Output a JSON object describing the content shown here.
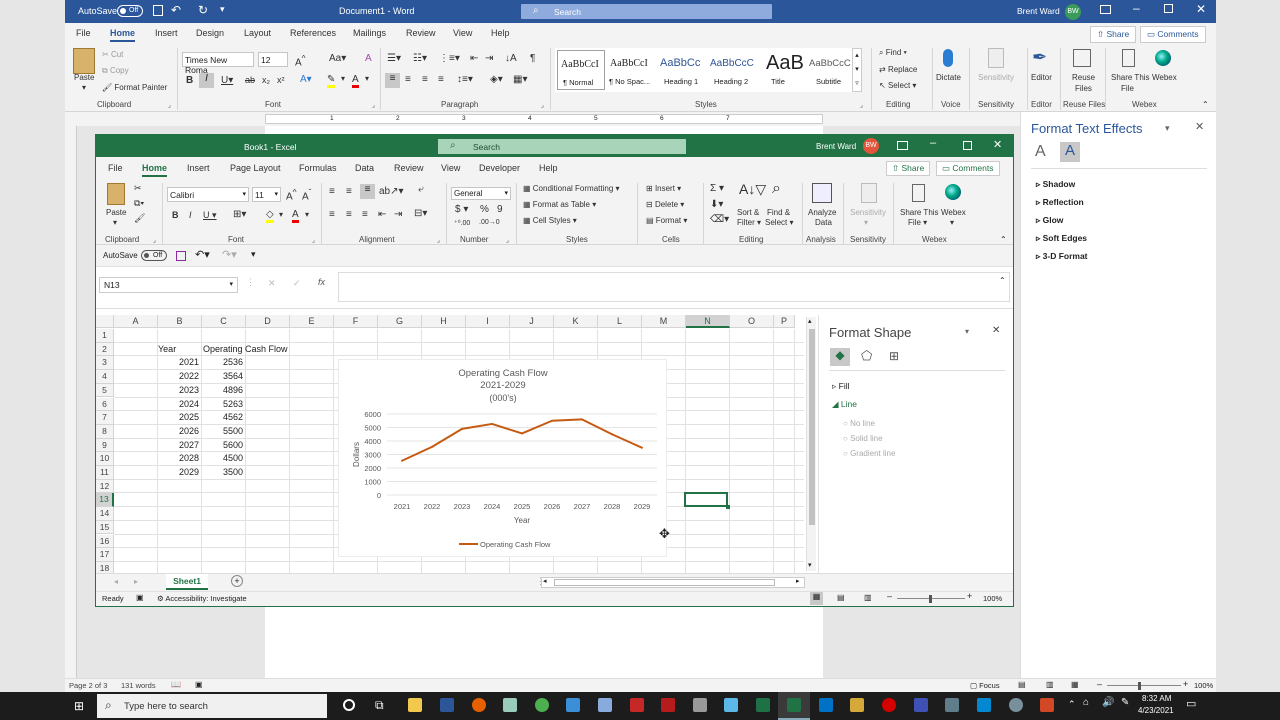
{
  "word": {
    "autosave_label": "AutoSave",
    "autosave_state": "Off",
    "doc_title": "Document1 - Word",
    "search_placeholder": "Search",
    "user_name": "Brent Ward",
    "user_initials": "BW",
    "tabs": [
      "File",
      "Home",
      "Insert",
      "Design",
      "Layout",
      "References",
      "Mailings",
      "Review",
      "View",
      "Help"
    ],
    "share": "Share",
    "comments": "Comments",
    "clipboard": {
      "paste": "Paste",
      "cut": "Cut",
      "copy": "Copy",
      "format_painter": "Format Painter",
      "label": "Clipboard"
    },
    "font": {
      "name": "Times New Roma",
      "size": "12",
      "label": "Font"
    },
    "paragraph_label": "Paragraph",
    "styles": [
      {
        "preview": "AaBbCcI",
        "name": "¶ Normal"
      },
      {
        "preview": "AaBbCcI",
        "name": "¶ No Spac..."
      },
      {
        "preview": "AaBbCc",
        "name": "Heading 1"
      },
      {
        "preview": "AaBbCcC",
        "name": "Heading 2"
      },
      {
        "preview": "AaB",
        "name": "Title"
      },
      {
        "preview": "AaBbCcC",
        "name": "Subtitle"
      }
    ],
    "styles_label": "Styles",
    "editing": {
      "find": "Find",
      "replace": "Replace",
      "select": "Select",
      "label": "Editing"
    },
    "voice": {
      "dictate": "Dictate",
      "label": "Voice"
    },
    "sensitivity": {
      "btn": "Sensitivity",
      "label": "Sensitivity"
    },
    "editor": {
      "btn": "Editor",
      "label": "Editor"
    },
    "reuse": {
      "btn1": "Reuse",
      "btn2": "Files",
      "label": "Reuse Files"
    },
    "webex": {
      "share1": "Share This",
      "share2": "File",
      "webex": "Webex",
      "label": "Webex"
    },
    "ruler_numbers": [
      "1",
      "2",
      "3",
      "4",
      "5",
      "6",
      "7"
    ],
    "status": {
      "page": "Page 2 of 3",
      "words": "131 words",
      "focus": "Focus",
      "zoom": "100%"
    },
    "fte": {
      "title": "Format Text Effects",
      "items": [
        "Shadow",
        "Reflection",
        "Glow",
        "Soft Edges",
        "3-D Format"
      ]
    }
  },
  "excel": {
    "title": "Book1 - Excel",
    "search_placeholder": "Search",
    "user_name": "Brent Ward",
    "user_initials": "BW",
    "tabs": [
      "File",
      "Home",
      "Insert",
      "Page Layout",
      "Formulas",
      "Data",
      "Review",
      "View",
      "Developer",
      "Help"
    ],
    "share": "Share",
    "comments": "Comments",
    "clipboard": {
      "paste": "Paste",
      "label": "Clipboard"
    },
    "font": {
      "name": "Calibri",
      "size": "11",
      "label": "Font"
    },
    "alignment_label": "Alignment",
    "number": {
      "format": "General",
      "label": "Number"
    },
    "styles": {
      "conditional": "Conditional Formatting",
      "table": "Format as Table",
      "cell": "Cell Styles",
      "label": "Styles"
    },
    "cells": {
      "insert": "Insert",
      "delete": "Delete",
      "format": "Format",
      "label": "Cells"
    },
    "editing": {
      "sort1": "Sort &",
      "sort2": "Filter",
      "find1": "Find &",
      "find2": "Select",
      "label": "Editing"
    },
    "analysis": {
      "btn1": "Analyze",
      "btn2": "Data",
      "label": "Analysis"
    },
    "sensitivity": {
      "btn": "Sensitivity",
      "label": "Sensitivity"
    },
    "webex": {
      "share1": "Share This",
      "share2": "File",
      "webex": "Webex",
      "label": "Webex"
    },
    "autosave_label": "AutoSave",
    "autosave_state": "Off",
    "name_box": "N13",
    "fx": "fx",
    "columns": [
      "A",
      "B",
      "C",
      "D",
      "E",
      "F",
      "G",
      "H",
      "I",
      "J",
      "K",
      "L",
      "M",
      "N",
      "O",
      "P"
    ],
    "rows": [
      "1",
      "2",
      "3",
      "4",
      "5",
      "6",
      "7",
      "8",
      "9",
      "10",
      "11",
      "12",
      "13",
      "14",
      "15",
      "16",
      "17",
      "18"
    ],
    "header_year": "Year",
    "header_ocf": "Operating Cash Flow",
    "years": [
      "2021",
      "2022",
      "2023",
      "2024",
      "2025",
      "2026",
      "2027",
      "2028",
      "2029"
    ],
    "amounts": [
      "2536",
      "3564",
      "4896",
      "5263",
      "4562",
      "5500",
      "5600",
      "4500",
      "3500"
    ],
    "sheet_tab": "Sheet1",
    "status": {
      "ready": "Ready",
      "accessibility": "Accessibility: Investigate",
      "zoom": "100%"
    },
    "format_shape": {
      "title": "Format Shape",
      "fill": "Fill",
      "line": "Line",
      "options": [
        "No line",
        "Solid line",
        "Gradient line"
      ]
    }
  },
  "chart_data": {
    "type": "line",
    "title": "Operating Cash Flow",
    "subtitle": "2021-2029",
    "subtitle2": "(000's)",
    "xlabel": "Year",
    "ylabel": "Dollars",
    "categories": [
      "2021",
      "2022",
      "2023",
      "2024",
      "2025",
      "2026",
      "2027",
      "2028",
      "2029"
    ],
    "yticks": [
      "0",
      "1000",
      "2000",
      "3000",
      "4000",
      "5000",
      "6000"
    ],
    "ylim": [
      0,
      6000
    ],
    "series": [
      {
        "name": "Operating Cash Flow",
        "values": [
          2536,
          3564,
          4896,
          5263,
          4562,
          5500,
          5600,
          4500,
          3500
        ],
        "color": "#c55a11"
      }
    ],
    "legend": "bottom",
    "grid": true
  },
  "taskbar": {
    "search_placeholder": "Type here to search",
    "time": "8:32 AM",
    "date": "4/23/2021"
  }
}
